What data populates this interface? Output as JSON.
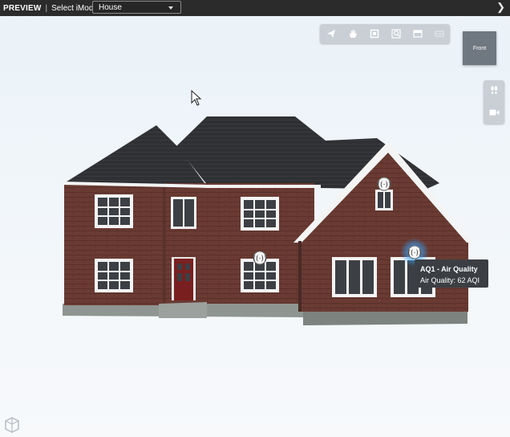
{
  "topbar": {
    "preview_label": "PREVIEW",
    "separator": "|",
    "select_label": "Select iModel:",
    "imodel_selected": "House"
  },
  "toolbar": {
    "icons": [
      "select-arrow-icon",
      "pan-hand-icon",
      "fit-view-icon",
      "zoom-icon",
      "section-icon",
      "measure-icon"
    ]
  },
  "view_cube": {
    "face_label": "Front"
  },
  "side_tools": {
    "icons": [
      "walk-icon",
      "camera-icon"
    ]
  },
  "sensors": [
    {
      "name": "sensor-marker-gable"
    },
    {
      "name": "sensor-marker-center"
    },
    {
      "name": "sensor-marker-aq1",
      "highlighted": true
    }
  ],
  "tooltip": {
    "title": "AQ1 - Air Quality",
    "value": "Air Quality: 62 AQI"
  },
  "colors": {
    "brick": "#6a3b33",
    "roof": "#2f3033",
    "trim": "#f4f4f4",
    "door": "#7a1f1f",
    "sensor_glow": "#33a3ff"
  }
}
